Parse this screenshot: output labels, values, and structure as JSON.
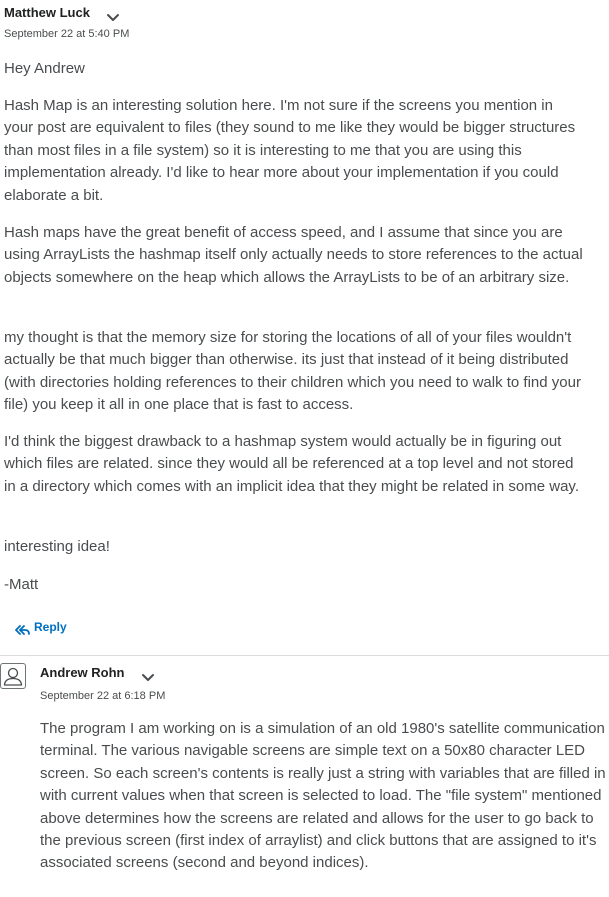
{
  "post1": {
    "author": "Matthew Luck",
    "timestamp": "September 22 at 5:40 PM",
    "greeting": "Hey Andrew",
    "paragraphs": [
      "Hash Map is an interesting solution here. I'm not sure if the screens you mention in your post are equivalent to files (they sound to me like they would be bigger structures than most files in a file system) so it is interesting to me that you are using this implementation already. I'd like to hear more about your implementation if you could elaborate a bit.",
      "Hash maps have the great benefit of access speed, and I assume that since you are using ArrayLists the hashmap itself only actually needs to store references to the actual objects somewhere on the heap which allows the ArrayLists to be of an arbitrary size.",
      "my thought is that the memory size for storing the locations of all of your files wouldn't actually be that much bigger than otherwise. its just that instead of it being distributed (with directories holding references to their children which you need to walk to find your file) you keep it all in one place that is fast to access.",
      "I'd think the biggest drawback to a hashmap system would actually be in figuring out which files are related. since they would all be referenced at a top level and not stored in a directory which comes with an implicit idea that they might be related in some way.",
      "interesting idea!"
    ],
    "signature": "-Matt",
    "reply_label": "Reply"
  },
  "post2": {
    "author": "Andrew Rohn",
    "timestamp": "September 22 at 6:18 PM",
    "paragraphs": [
      "The program I am working on is a simulation of an old 1980's satellite communication terminal. The various navigable screens are simple text on a 50x80 character LED screen. So each screen's contents is really just a string  with variables that are filled in with current values when that screen is selected to load. The \"file system\" mentioned above determines how the screens are related and allows for the user to go back to the previous screen (first index of arraylist) and click buttons that are assigned to it's associated screens (second and beyond indices)."
    ]
  },
  "icons": {
    "author_menu": "chevron-down-icon",
    "reply": "reply-arrow-icon",
    "avatar": "user-avatar-icon"
  },
  "colors": {
    "link": "#006fbf",
    "text": "#494c4e",
    "divider": "#d9dbdd"
  }
}
